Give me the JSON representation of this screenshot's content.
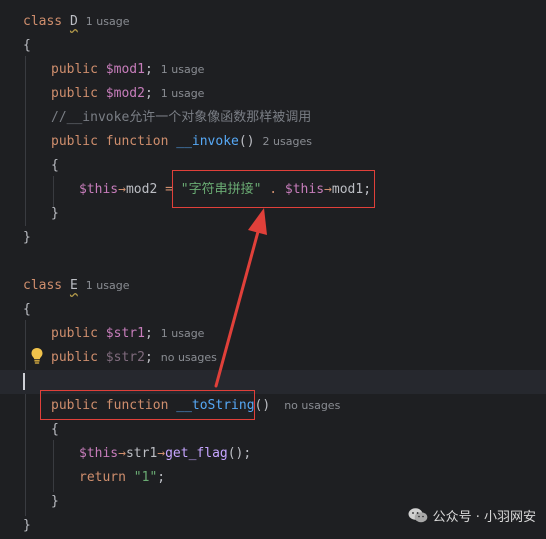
{
  "editor": {
    "lines": [
      {
        "class_kw": "class",
        "class_name": "D",
        "hint": "1 usage"
      },
      {
        "text": "{"
      },
      {
        "kw": "public",
        "var": "$mod1",
        "end": ";",
        "hint": "1 usage"
      },
      {
        "kw": "public",
        "var": "$mod2",
        "end": ";",
        "hint": "1 usage"
      },
      {
        "comment": "//__invoke允许一个对象像函数那样被调用"
      },
      {
        "kw1": "public",
        "kw2": "function",
        "fn": "__invoke",
        "parens": "()",
        "hint": "2 usages"
      },
      {
        "text": "{"
      },
      {
        "this1": "$this",
        "arrow1": "→",
        "prop1": "mod2",
        "eq": " = ",
        "str": "\"字符串拼接\"",
        "dot": " . ",
        "this2": "$this",
        "arrow2": "→",
        "prop2": "mod1",
        "end": ";"
      },
      {
        "text": "}"
      },
      {
        "text": "}"
      },
      {
        "class_kw": "class",
        "class_name": "E",
        "hint": "1 usage"
      },
      {
        "text": "{"
      },
      {
        "kw": "public",
        "var": "$str1",
        "end": ";",
        "hint": "1 usage"
      },
      {
        "kw": "public",
        "var": "$str2",
        "end": ";",
        "hint": "no usages"
      },
      {
        "kw1": "public",
        "kw2": "function",
        "fn": "__toString",
        "parens": "()",
        "hint": "no usages"
      },
      {
        "text": "{"
      },
      {
        "this1": "$this",
        "arrow1": "→",
        "prop1": "str1",
        "arrow2": "→",
        "call": "get_flag",
        "parens": "()",
        "end": ";"
      },
      {
        "kw": "return",
        "str": "\"1\"",
        "end": ";"
      },
      {
        "text": "}"
      },
      {
        "text": "}"
      }
    ]
  },
  "colors": {
    "highlight_box": "#e0403a",
    "arrow": "#e0403a",
    "background": "#1e1f22"
  },
  "watermark": {
    "icon": "wechat-icon",
    "text": "公众号 · 小羽网安"
  }
}
